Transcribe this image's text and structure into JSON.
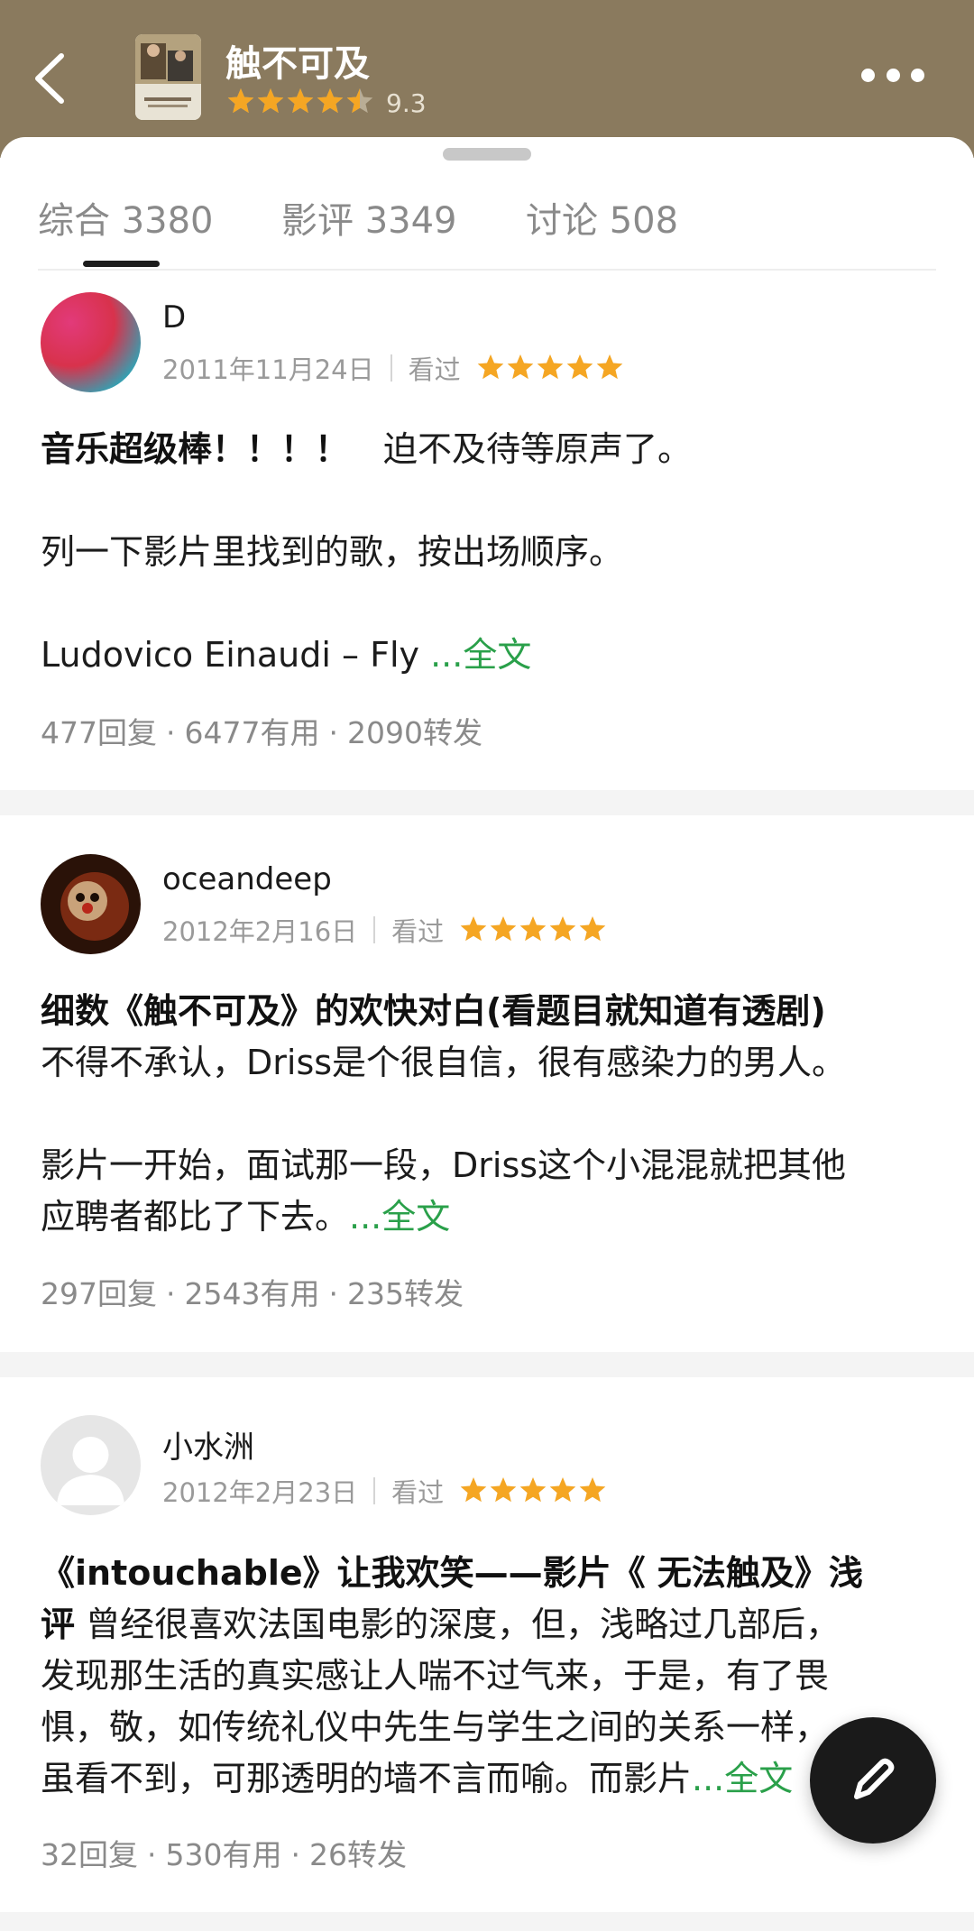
{
  "header": {
    "title": "触不可及",
    "rating": "9.3",
    "rating_stars": 4.5,
    "star_color": "#f5a623"
  },
  "tabs": [
    {
      "label": "综合 3380",
      "active": true
    },
    {
      "label": "影评 3349",
      "active": false
    },
    {
      "label": "讨论 508",
      "active": false
    }
  ],
  "reviews": [
    {
      "user": "D",
      "date": "2011年11月24日",
      "status": "看过",
      "stars": 5,
      "title": "音乐超级棒！！！！",
      "line1_rest": "　迫不及待等原声了。",
      "line2": "列一下影片里找到的歌，按出场顺序。",
      "line3": "Ludovico Einaudi – Fly ",
      "more": "...全文",
      "replies": "477回复",
      "useful": "6477有用",
      "shares": "2090转发"
    },
    {
      "user": "oceandeep",
      "date": "2012年2月16日",
      "status": "看过",
      "stars": 5,
      "title": "细数《触不可及》的欢快对白(看题目就知道有透剧)",
      "line1": "不得不承认，Driss是个很自信，很有感染力的男人。",
      "line2": "影片一开始，面试那一段，Driss这个小混混就把其他",
      "line3": "应聘者都比了下去。",
      "more": "...全文",
      "replies": "297回复",
      "useful": "2543有用",
      "shares": "235转发"
    },
    {
      "user": "小水洲",
      "date": "2012年2月23日",
      "status": "看过",
      "stars": 5,
      "title_a": "《intouchable》让我欢笑——影片《 无法触及》浅",
      "title_b": "评",
      "line1_rest": " 曾经很喜欢法国电影的深度，但，浅略过几部后，",
      "line2": "发现那生活的真实感让人喘不过气来，于是，有了畏",
      "line3": "惧，敬，如传统礼仪中先生与学生之间的关系一样，",
      "line4": "虽看不到，可那透明的墙不言而喻。而影片",
      "more": "...全文",
      "replies": "32回复",
      "useful": "530有用",
      "shares": "26转发"
    }
  ],
  "stat_separator": "·",
  "icons": {
    "back": "chevron-left-icon",
    "more": "more-dots-icon",
    "fab": "pencil-icon"
  },
  "colors": {
    "header_bg": "#8a7a5e",
    "link_green": "#2aa04a",
    "star_orange": "#f5a623"
  }
}
